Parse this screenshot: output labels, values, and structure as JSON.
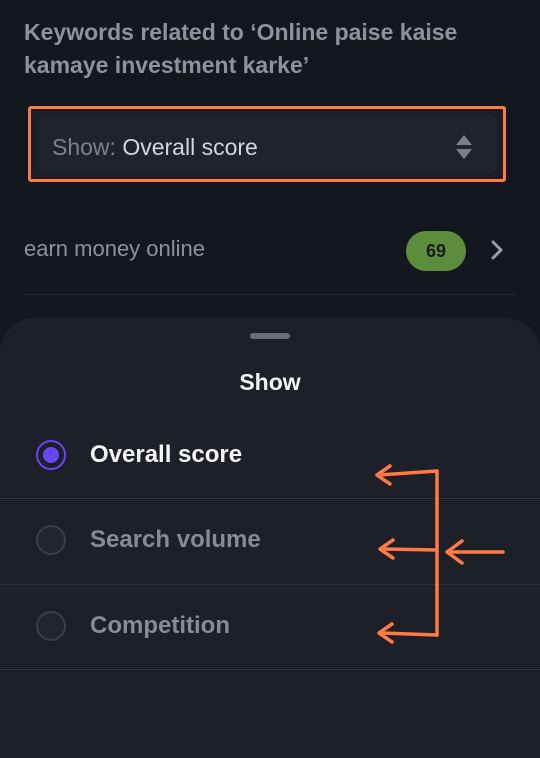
{
  "heading": "Keywords related to ‘Online paise kaise kamaye investment karke’",
  "select": {
    "prefix": "Show:",
    "value": "Overall score",
    "icon": "sort-updown-icon"
  },
  "keyword_row": {
    "text": "earn money online",
    "score": "69",
    "icon": "chevron-right-icon"
  },
  "sheet": {
    "title": "Show",
    "options": [
      {
        "label": "Overall score",
        "selected": true
      },
      {
        "label": "Search volume",
        "selected": false
      },
      {
        "label": "Competition",
        "selected": false
      }
    ]
  },
  "colors": {
    "background": "#15171f",
    "sheet": "#1e2029",
    "accent": "#6a45f2",
    "highlight": "#ff7a45",
    "badge": "#5c8d3d"
  }
}
